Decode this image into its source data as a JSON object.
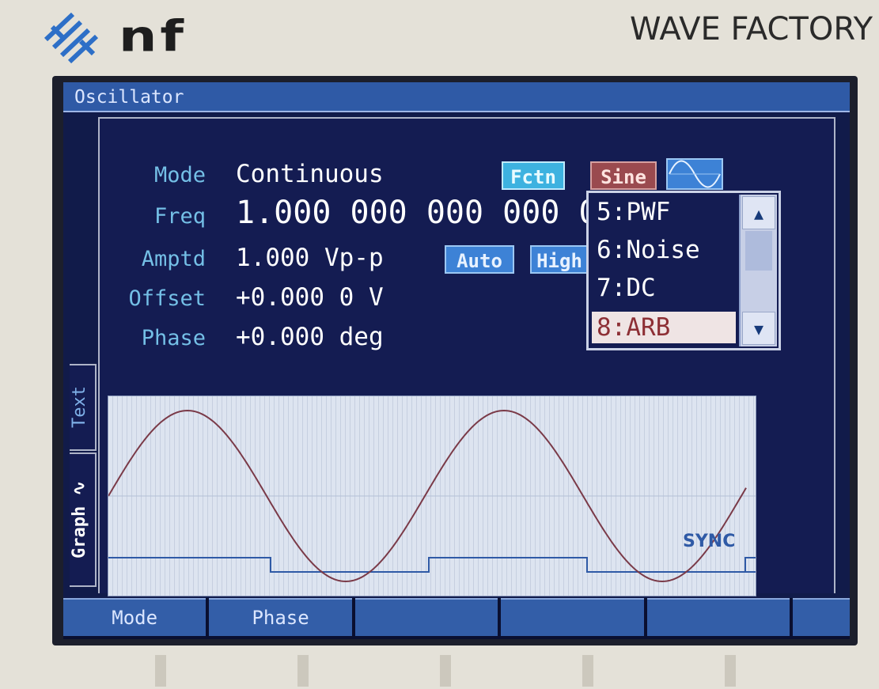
{
  "device": {
    "brand": "nf",
    "product": "WAVE FACTORY"
  },
  "window": {
    "title": "Oscillator"
  },
  "parameters": [
    {
      "label": "Mode",
      "value": "Continuous"
    },
    {
      "label": "Freq",
      "value": "1.000 000 000 000 0"
    },
    {
      "label": "Amptd",
      "value": "1.000 Vp-p"
    },
    {
      "label": "Offset",
      "value": "+0.000 0 V"
    },
    {
      "label": "Phase",
      "value": "+0.000 deg"
    }
  ],
  "buttons": {
    "fctn": "Fctn",
    "sine": "Sine",
    "auto": "Auto",
    "high": "High"
  },
  "function_dropdown": {
    "items": [
      "5:PWF",
      "6:Noise",
      "7:DC",
      "8:ARB"
    ],
    "selected": "8:ARB"
  },
  "side_tabs": {
    "text": "Text",
    "graph": "Graph"
  },
  "graph": {
    "sync_label": "SYNC",
    "trace_color": "#7a3a48",
    "sync_color": "#2f5aa6"
  },
  "softkeys": [
    "Mode",
    "Phase",
    "",
    "",
    "",
    ""
  ],
  "colors": {
    "screen_bg": "#111b4a",
    "titlebar": "#2f5aa6",
    "selected_item_text": "#8d2f35"
  }
}
